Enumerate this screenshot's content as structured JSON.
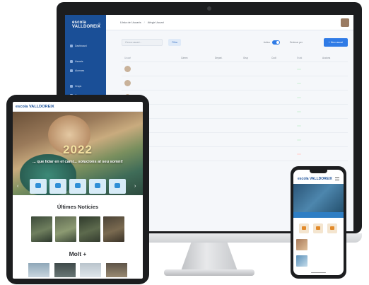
{
  "monitor": {
    "app": {
      "logo": "escola VALLDOREIX",
      "nav": [
        {
          "label": "",
          "section": true
        },
        {
          "label": "Dashboard",
          "section": false
        },
        {
          "label": "",
          "section": true
        },
        {
          "label": "Usuaris",
          "section": false
        },
        {
          "label": "Alumnes",
          "section": false
        },
        {
          "label": "",
          "section": true
        },
        {
          "label": "Grups",
          "section": false
        },
        {
          "label": "Cursos",
          "section": false
        }
      ],
      "breadcrumb": [
        "Llista de Usuaris",
        "Afegir Usuari"
      ],
      "user_label": "",
      "search_placeholder": "Cerca usuari...",
      "search_button": "Filtra",
      "toggle_label": "Actius",
      "filter_label": "Ordenar per",
      "filter_value": "",
      "new_button": "+ Nou usuari",
      "columns": [
        "Usuari",
        "Càrrec",
        "Depart.",
        "Grup",
        "Codi",
        "Estat",
        "Accions"
      ],
      "rows": [
        {
          "name": "",
          "role": "",
          "dept": "",
          "group": "",
          "code": "",
          "status": "",
          "status_color": "green",
          "action": ""
        },
        {
          "name": "",
          "role": "",
          "dept": "",
          "group": "",
          "code": "",
          "status": "",
          "status_color": "green",
          "action": ""
        },
        {
          "name": "",
          "role": "",
          "dept": "",
          "group": "",
          "code": "",
          "status": "",
          "status_color": "green",
          "action": ""
        },
        {
          "name": "",
          "role": "",
          "dept": "",
          "group": "",
          "code": "",
          "status": "",
          "status_color": "green",
          "action": ""
        },
        {
          "name": "",
          "role": "",
          "dept": "",
          "group": "",
          "code": "",
          "status": "",
          "status_color": "green",
          "action": ""
        },
        {
          "name": "",
          "role": "",
          "dept": "",
          "group": "",
          "code": "",
          "status": "",
          "status_color": "green",
          "action": ""
        },
        {
          "name": "",
          "role": "",
          "dept": "",
          "group": "",
          "code": "",
          "status": "",
          "status_color": "red",
          "action": ""
        },
        {
          "name": "",
          "role": "",
          "dept": "",
          "group": "",
          "code": "",
          "status": "",
          "status_color": "green",
          "action": ""
        }
      ]
    }
  },
  "tablet": {
    "logo": "escola VALLDOREIX",
    "menu": [
      "",
      "",
      "",
      "",
      "",
      ""
    ],
    "hero_year": "2022",
    "hero_tagline": "... que lidar en el camí... solucions al seu somni!",
    "tiles": [
      "",
      "",
      "",
      "",
      ""
    ],
    "news_title": "Últimes Notícies",
    "more_title": "Molt +"
  },
  "phone": {
    "logo": "escola VALLDOREIX",
    "hero_text": "",
    "hero_bar": "",
    "items": [
      "",
      ""
    ]
  },
  "colors": {
    "brand_blue": "#1a4f97",
    "accent_blue": "#2f7be6",
    "device_black": "#1c1d1f",
    "status_green": "#2e9c58",
    "status_red": "#d43b3b"
  }
}
